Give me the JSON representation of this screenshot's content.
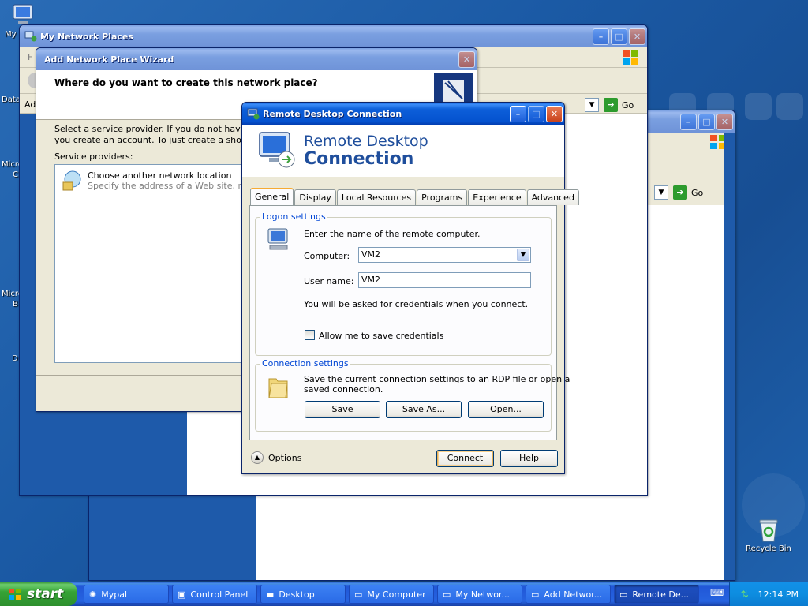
{
  "desktop": {
    "icons": {
      "my_docs": "My",
      "data": "Data",
      "micro1": "Micro",
      "micro1b": "C",
      "micro2": "Micro",
      "micro2b": "B",
      "d": "D",
      "recycle": "Recycle Bin"
    }
  },
  "network_window": {
    "title": "My Network Places",
    "menu_fragment": "F",
    "address_fragment": "Ad",
    "go_label": "Go"
  },
  "back_window": {
    "go_label": "Go"
  },
  "wizard": {
    "title": "Add Network Place Wizard",
    "heading": "Where do you want to create this network place?",
    "description_line1": "Select a service provider.  If you do not have a me",
    "description_line2": "you create an account.  To just create a shortcut,",
    "providers_label": "Service providers:",
    "provider_name": "Choose another network location",
    "provider_desc": "Specify the address of a Web site, netwo"
  },
  "rdc": {
    "title": "Remote Desktop Connection",
    "banner_line1": "Remote Desktop",
    "banner_line2": "Connection",
    "tabs": [
      "General",
      "Display",
      "Local Resources",
      "Programs",
      "Experience",
      "Advanced"
    ],
    "logon": {
      "title": "Logon settings",
      "prompt": "Enter the name of the remote computer.",
      "computer_label": "Computer:",
      "computer_value": "VM2",
      "username_label": "User name:",
      "username_value": "VM2",
      "credentials_note": "You will be asked for credentials when you connect.",
      "save_credentials_label": "Allow me to save credentials"
    },
    "connection": {
      "title": "Connection settings",
      "desc_line1": "Save the current connection settings to an RDP file or open a",
      "desc_line2": "saved connection.",
      "save": "Save",
      "save_as": "Save As...",
      "open": "Open..."
    },
    "options": "Options",
    "connect": "Connect",
    "help": "Help"
  },
  "taskbar": {
    "start": "start",
    "items": [
      "Mypal",
      "Control Panel",
      "Desktop",
      "My Computer",
      "My Networ...",
      "Add Networ...",
      "Remote De..."
    ],
    "clock": "12:14 PM"
  },
  "colors": {
    "titlebar": "#0452cf",
    "desktop": "#1f5ea8",
    "group_title": "#0046d5"
  }
}
